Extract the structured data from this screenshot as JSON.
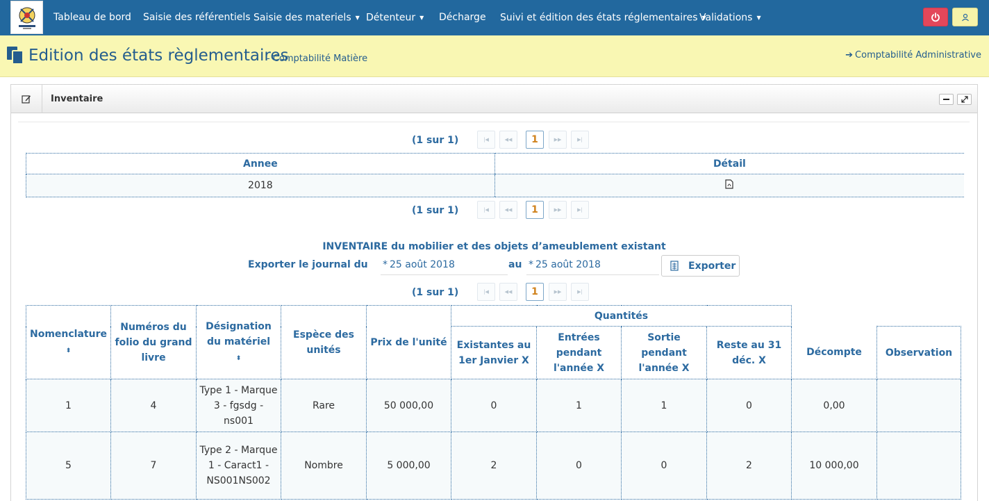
{
  "navbar": {
    "items": [
      {
        "label": "Tableau de bord"
      },
      {
        "label": "Saisie des référentiels"
      },
      {
        "label": "Saisie des materiels"
      },
      {
        "label": "Détenteur"
      },
      {
        "label": "Décharge"
      },
      {
        "label": "Suivi et édition des états réglementaires"
      },
      {
        "label": "Validations"
      }
    ],
    "power_icon": "power-icon",
    "user_icon": "user-icon",
    "colors": {
      "background": "#22689e",
      "power": "#e3475a",
      "user": "#f6f3a9"
    }
  },
  "header": {
    "title": "Edition des états règlementaires",
    "subtitle": "- Comptabilité Matière",
    "admin_link": "Comptabilité Administrative",
    "background": "#f9f7b3"
  },
  "panel": {
    "title": "Inventaire"
  },
  "pager": {
    "count": "(1 sur 1)",
    "current_page": "1"
  },
  "annee_table": {
    "headers": [
      "Annee",
      "Détail"
    ],
    "rows": [
      {
        "annee": "2018",
        "detail_icon": "pdf-file-icon"
      }
    ]
  },
  "export": {
    "title": "INVENTAIRE du mobilier et des objets d’ameublement existant",
    "label_from": "Exporter le journal du",
    "date_from": "25 août 2018",
    "label_to": "au",
    "date_to": "25 août 2018",
    "required_mark": "*",
    "button_label": "Exporter"
  },
  "inventory_table": {
    "headers": {
      "nomenclature": "Nomenclature",
      "folio": "Numéros du folio du grand livre",
      "designation": "Désignation du matériel",
      "espece": "Espèce des unités",
      "prix": "Prix de l'unité",
      "quantites": "Quantités",
      "existantes": "Existantes au 1er Janvier X",
      "entrees": "Entrées pendant l'année X",
      "sortie": "Sortie pendant l'année X",
      "reste": "Reste au 31 déc. X",
      "decompte": "Décompte",
      "observation": "Observation"
    },
    "rows": [
      {
        "nomenclature": "1",
        "folio": "4",
        "designation": "Type 1 - Marque 3 - fgsdg - ns001",
        "espece": "Rare",
        "prix": "50 000,00",
        "existantes": "0",
        "entrees": "1",
        "sortie": "1",
        "reste": "0",
        "decompte": "0,00",
        "observation": ""
      },
      {
        "nomenclature": "5",
        "folio": "7",
        "designation": "Type 2 - Marque 1 - Caract1 - NS001NS002",
        "espece": "Nombre",
        "prix": "5 000,00",
        "existantes": "2",
        "entrees": "0",
        "sortie": "0",
        "reste": "2",
        "decompte": "10 000,00",
        "observation": ""
      }
    ]
  }
}
